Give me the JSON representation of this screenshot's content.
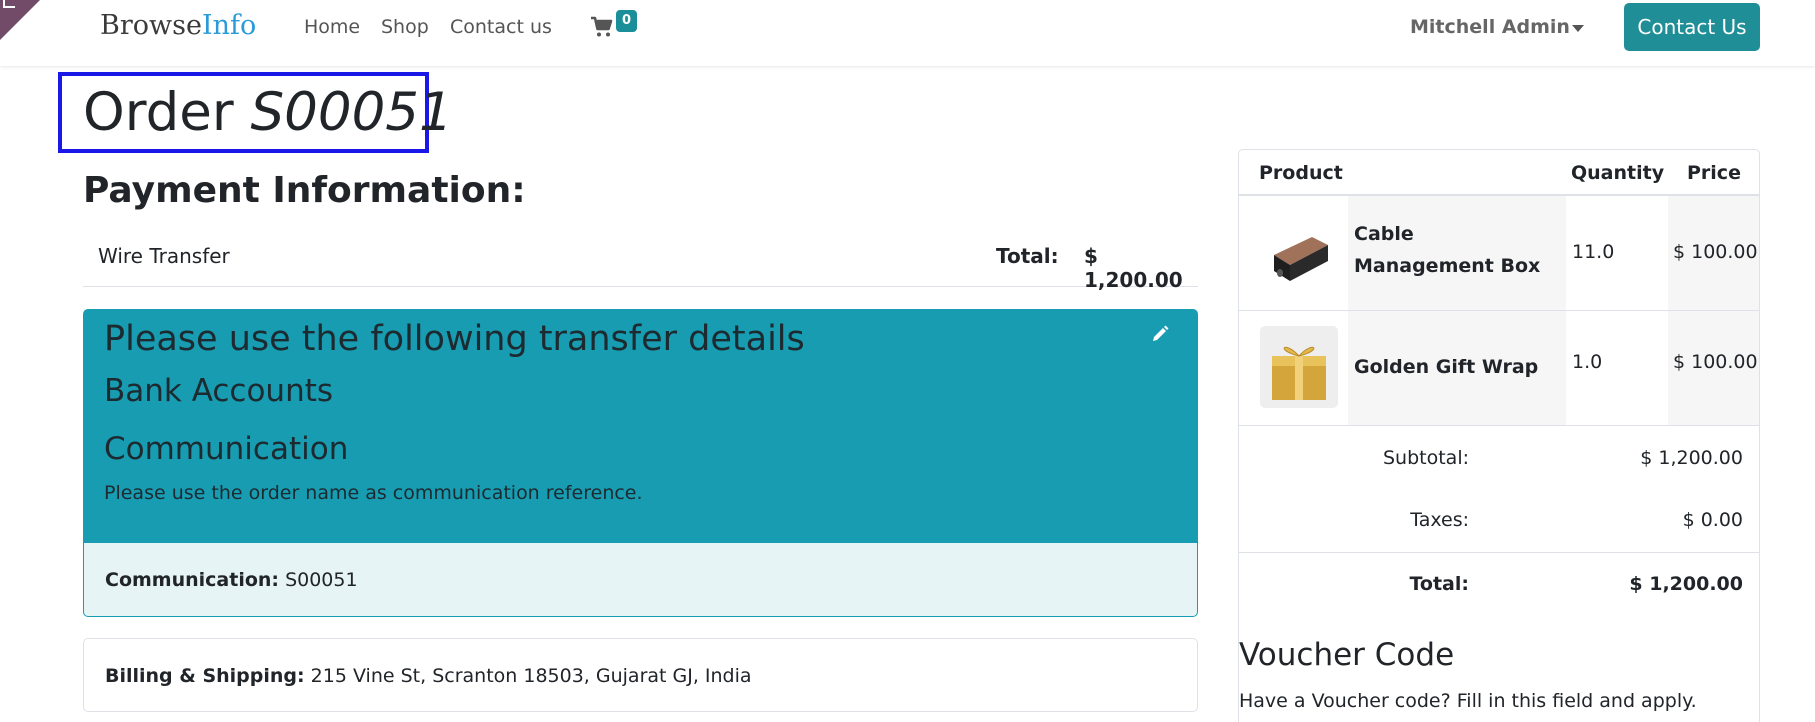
{
  "brand": {
    "part1": "Browse",
    "part2": "Info"
  },
  "nav": {
    "links": [
      "Home",
      "Shop",
      "Contact us"
    ],
    "cart_count": "0"
  },
  "user": {
    "name": "Mitchell Admin"
  },
  "header_button": "Contact Us",
  "order": {
    "label": "Order",
    "number": "S00051"
  },
  "payment": {
    "heading": "Payment Information:",
    "method": "Wire Transfer",
    "total_label": "Total:",
    "total_value": "$ 1,200.00"
  },
  "transfer": {
    "title": "Please use the following transfer details",
    "bank_heading": "Bank Accounts",
    "comm_heading": "Communication",
    "comm_text": "Please use the order name as communication reference.",
    "comm_label": "Communication:",
    "comm_value": "S00051"
  },
  "billing": {
    "label": "Billing & Shipping:",
    "value": "215 Vine St, Scranton 18503, Gujarat GJ, India"
  },
  "summary": {
    "headers": {
      "product": "Product",
      "quantity": "Quantity",
      "price": "Price"
    },
    "items": [
      {
        "name": "Cable Management Box",
        "qty": "11.0",
        "price": "$ 100.00",
        "thumb": "cable-box-image"
      },
      {
        "name": "Golden Gift Wrap",
        "qty": "1.0",
        "price": "$ 100.00",
        "thumb": "gift-wrap-image"
      }
    ],
    "subtotal_label": "Subtotal:",
    "subtotal_value": "$ 1,200.00",
    "taxes_label": "Taxes:",
    "taxes_value": "$ 0.00",
    "total_label": "Total:",
    "total_value": "$ 1,200.00"
  },
  "voucher": {
    "heading": "Voucher Code",
    "text": "Have a Voucher code? Fill in this field and apply."
  },
  "colors": {
    "accent": "#1f8e97",
    "transfer_bg": "#179cb2",
    "highlight_border": "#1a18e6"
  }
}
